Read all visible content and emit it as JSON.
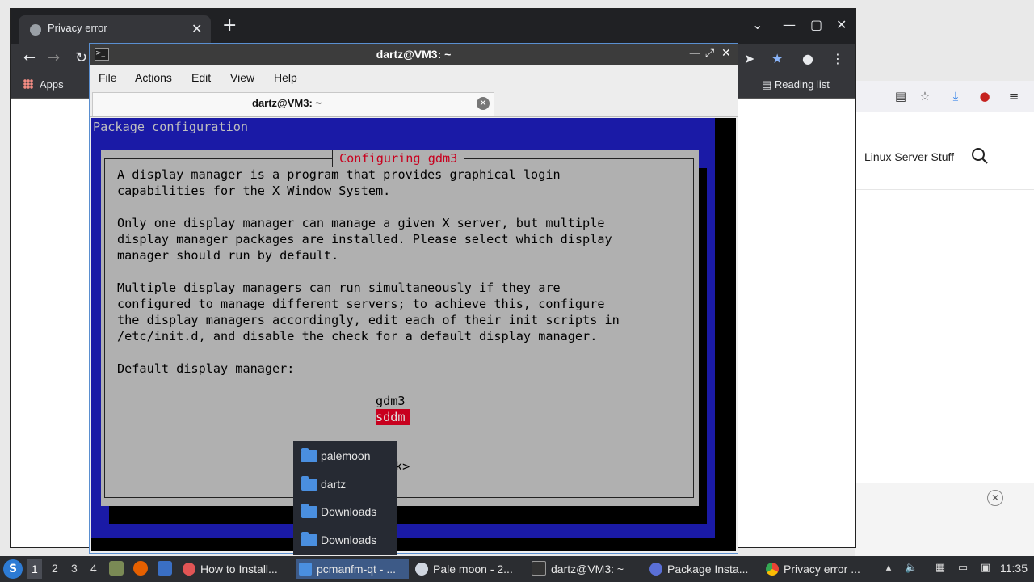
{
  "browser": {
    "tab_title": "Privacy error",
    "bookmarks": {
      "apps_label": "Apps",
      "reading_list_label": "Reading list"
    }
  },
  "background_page": {
    "site_nav_label": "Linux Server Stuff"
  },
  "terminal": {
    "window_title": "dartz@VM3: ~",
    "menu": [
      "File",
      "Actions",
      "Edit",
      "View",
      "Help"
    ],
    "tab_title": "dartz@VM3: ~",
    "tui": {
      "header": "Package configuration",
      "dialog_title": "Configuring gdm3",
      "body": "A display manager is a program that provides graphical login\ncapabilities for the X Window System.\n\nOnly one display manager can manage a given X server, but multiple\ndisplay manager packages are installed. Please select which display\nmanager should run by default.\n\nMultiple display managers can run simultaneously if they are\nconfigured to manage different servers; to achieve this, configure\nthe display managers accordingly, edit each of their init scripts in\n/etc/init.d, and disable the check for a default display manager.\n\nDefault display manager:",
      "options": [
        "gdm3",
        "sddm"
      ],
      "selected_option": "sddm",
      "ok_button_fragment": "k>"
    }
  },
  "folder_popup": {
    "items": [
      "palemoon",
      "dartz",
      "Downloads",
      "Downloads"
    ]
  },
  "taskbar": {
    "workspaces": [
      "1",
      "2",
      "3",
      "4"
    ],
    "active_workspace": "1",
    "tasks": [
      {
        "label": "How to Install...",
        "icon_color": "#e25555"
      },
      {
        "label": "pcmanfm-qt - ...",
        "icon_color": "#4a8fe0"
      },
      {
        "label": "Pale moon - 2...",
        "icon_color": "#d0d6e0"
      },
      {
        "label": "dartz@VM3: ~",
        "icon_color": "#333333"
      },
      {
        "label": "Package Insta...",
        "icon_color": "#5a6fd6"
      },
      {
        "label": "Privacy error ...",
        "icon_color": "#34a853"
      }
    ],
    "active_task": "pcmanfm-qt - ...",
    "clock": "11:35"
  },
  "colors": {
    "tui_background": "#1a1aa6",
    "tui_dialog": "#b0b0b0",
    "tui_accent": "#c8001e",
    "taskbar": "#2b2d31"
  }
}
